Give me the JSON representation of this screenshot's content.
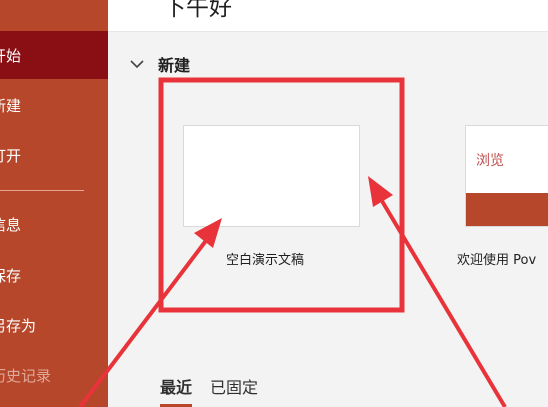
{
  "sidebar": {
    "items": [
      {
        "label": "开始",
        "state": "active"
      },
      {
        "label": "新建"
      },
      {
        "label": "打开"
      },
      {
        "label": "信息"
      },
      {
        "label": "保存"
      },
      {
        "label": "另存为"
      },
      {
        "label": "历史记录",
        "state": "disabled"
      }
    ]
  },
  "header": {
    "greeting": "下午好"
  },
  "new_section": {
    "title": "新建",
    "templates": [
      {
        "label": "空白演示文稿"
      },
      {
        "label": "欢迎使用 Pov",
        "thumb_text": "浏览"
      }
    ]
  },
  "tabs": [
    {
      "label": "最近",
      "state": "active"
    },
    {
      "label": "已固定"
    }
  ],
  "colors": {
    "accent": "#b7472a",
    "active_nav": "#8a0f15",
    "annotation": "#e8333a"
  }
}
